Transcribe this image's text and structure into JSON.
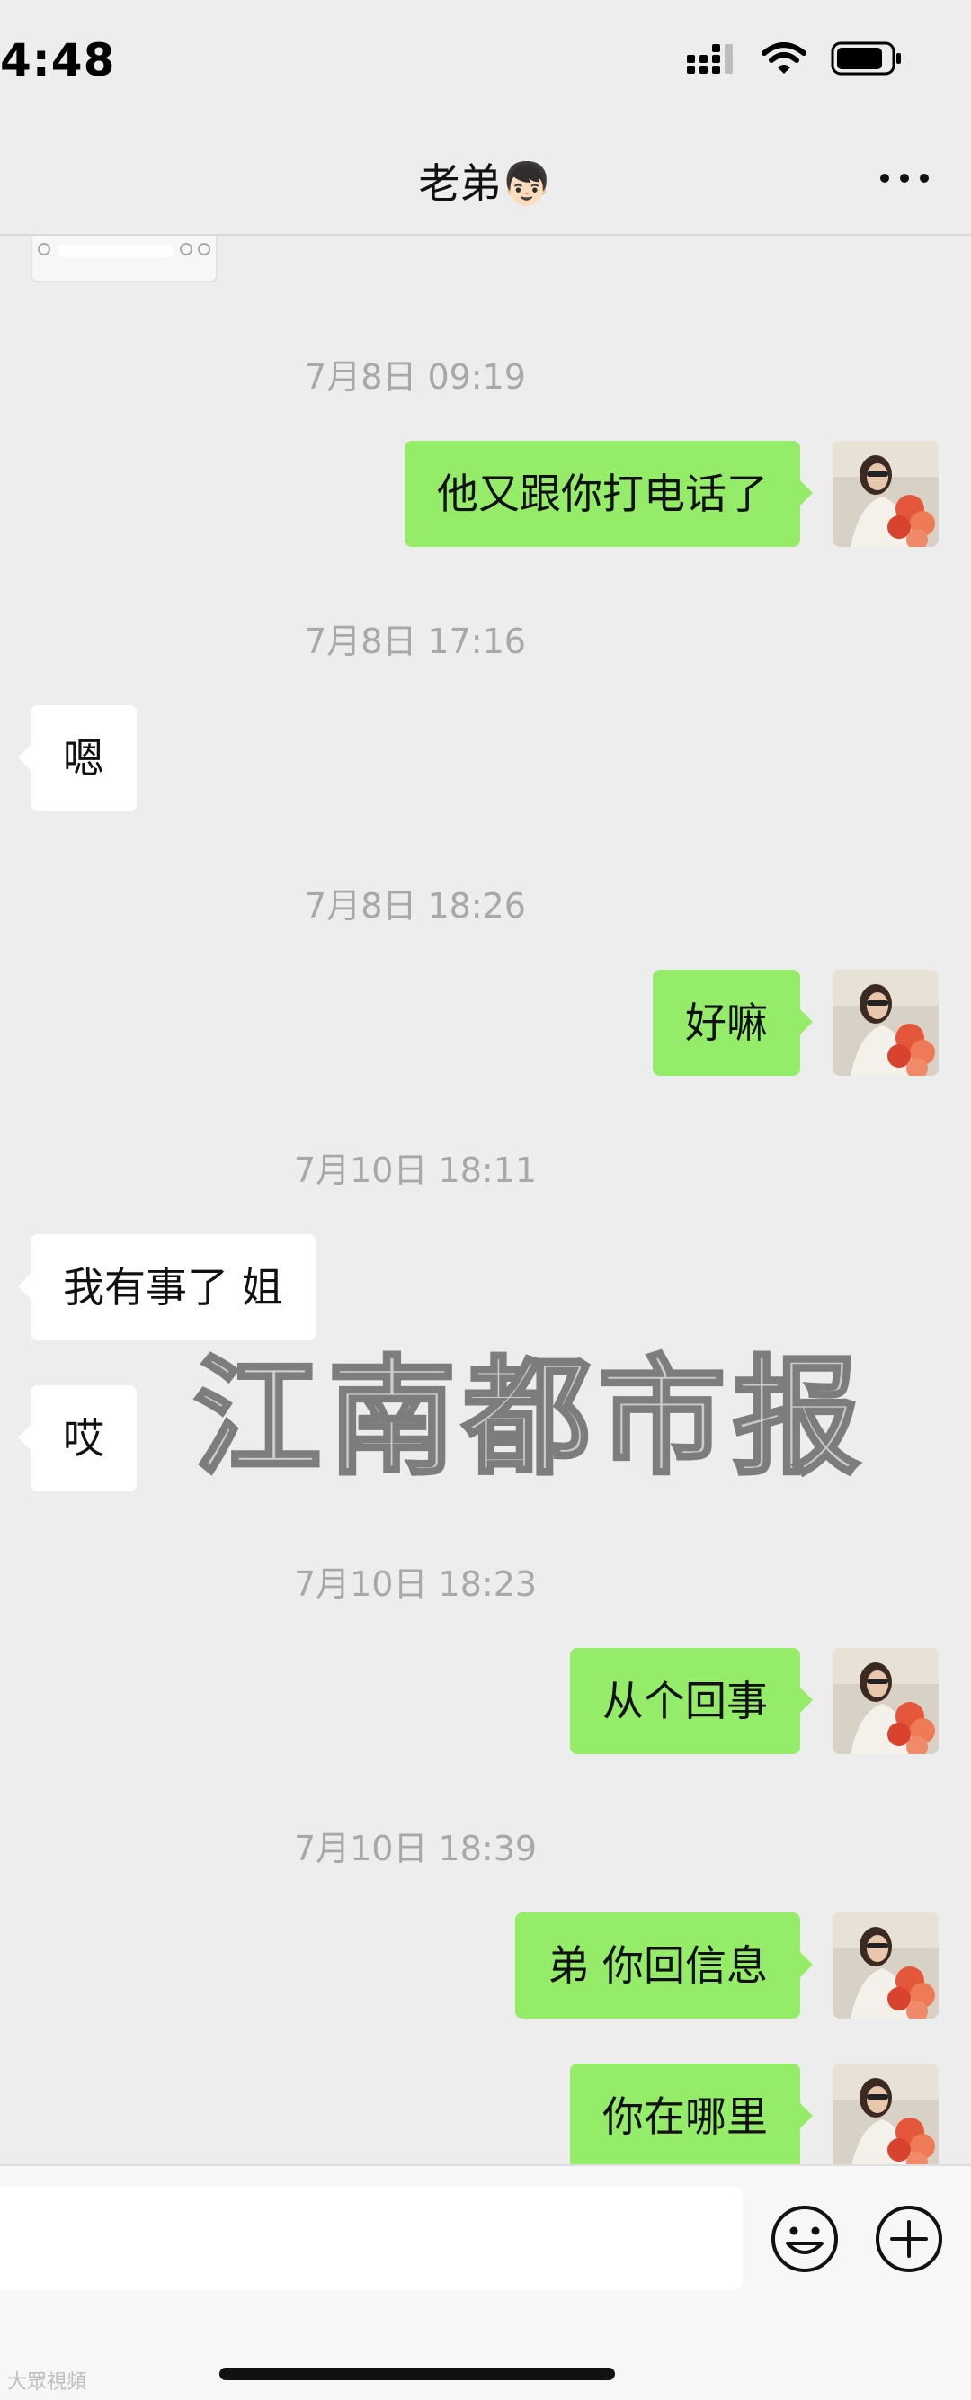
{
  "status_bar": {
    "time": "4:48"
  },
  "nav": {
    "title": "老弟👦🏻"
  },
  "messages": [
    {
      "type": "timestamp",
      "text": "7月8日 09:19"
    },
    {
      "type": "message",
      "direction": "out",
      "text": "他又跟你打电话了"
    },
    {
      "type": "timestamp",
      "text": "7月8日 17:16"
    },
    {
      "type": "message",
      "direction": "in",
      "text": "嗯"
    },
    {
      "type": "timestamp",
      "text": "7月8日 18:26"
    },
    {
      "type": "message",
      "direction": "out",
      "text": "好嘛"
    },
    {
      "type": "timestamp",
      "text": "7月10日 18:11"
    },
    {
      "type": "message",
      "direction": "in",
      "text": "我有事了 姐"
    },
    {
      "type": "message",
      "direction": "in",
      "text": "哎"
    },
    {
      "type": "timestamp",
      "text": "7月10日 18:23"
    },
    {
      "type": "message",
      "direction": "out",
      "text": "从个回事"
    },
    {
      "type": "timestamp",
      "text": "7月10日 18:39"
    },
    {
      "type": "message",
      "direction": "out",
      "text": "弟 你回信息"
    },
    {
      "type": "message",
      "direction": "out",
      "text": "你在哪里"
    }
  ],
  "watermark": "江南都市报",
  "source_mark": "大眾視頻",
  "colors": {
    "background": "#ededed",
    "outgoing_bubble": "#95ec69",
    "incoming_bubble": "#ffffff",
    "timestamp_text": "#a8a8a8"
  },
  "icons": {
    "nav_more": "more-dots-icon",
    "emoji": "emoji-face-icon",
    "plus": "plus-circle-icon",
    "signal": "cellular-signal-icon",
    "wifi": "wifi-icon",
    "battery": "battery-icon"
  }
}
